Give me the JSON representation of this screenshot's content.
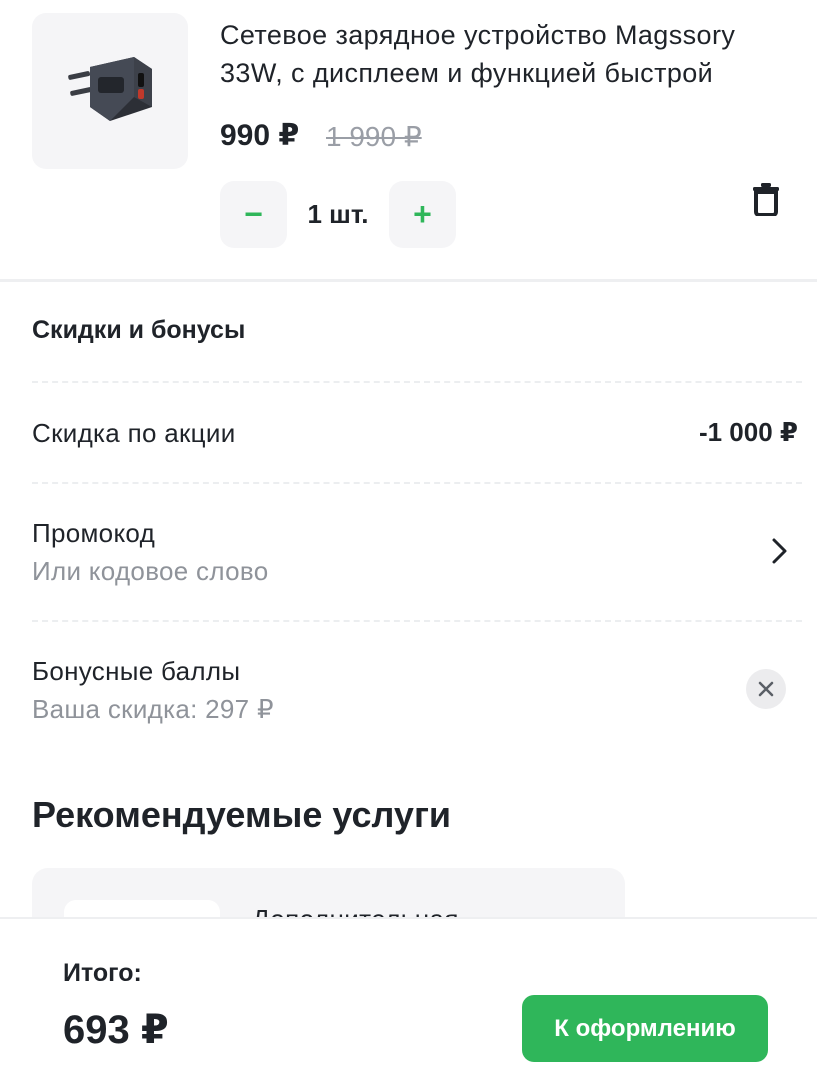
{
  "product": {
    "image_icon": "charger-image",
    "title": "Сетевое зарядное устройство Magssory 33W, с дисплеем и функцией быстрой",
    "price": "990 ₽",
    "old_price": "1 990 ₽",
    "quantity_label": "1 шт.",
    "minus_label": "−",
    "plus_label": "+",
    "delete_icon": "trash-icon"
  },
  "discounts": {
    "title": "Скидки и бонусы",
    "promo_discount": {
      "label": "Скидка по акции",
      "value": "-1 000 ₽"
    },
    "promocode": {
      "label": "Промокод",
      "sublabel": "Или кодовое слово",
      "icon": "chevron-right-icon"
    },
    "bonus": {
      "label": "Бонусные баллы",
      "sublabel": "Ваша скидка: 297 ₽",
      "icon": "close-icon"
    }
  },
  "recommended": {
    "title": "Рекомендуемые услуги",
    "card_text": "Дополнительная"
  },
  "footer": {
    "total_label": "Итого:",
    "total_value": "693 ₽",
    "checkout_label": "К оформлению"
  },
  "colors": {
    "accent": "#2fb65a",
    "text": "#1f2329",
    "muted": "#8f939a",
    "surface": "#f5f5f7"
  }
}
